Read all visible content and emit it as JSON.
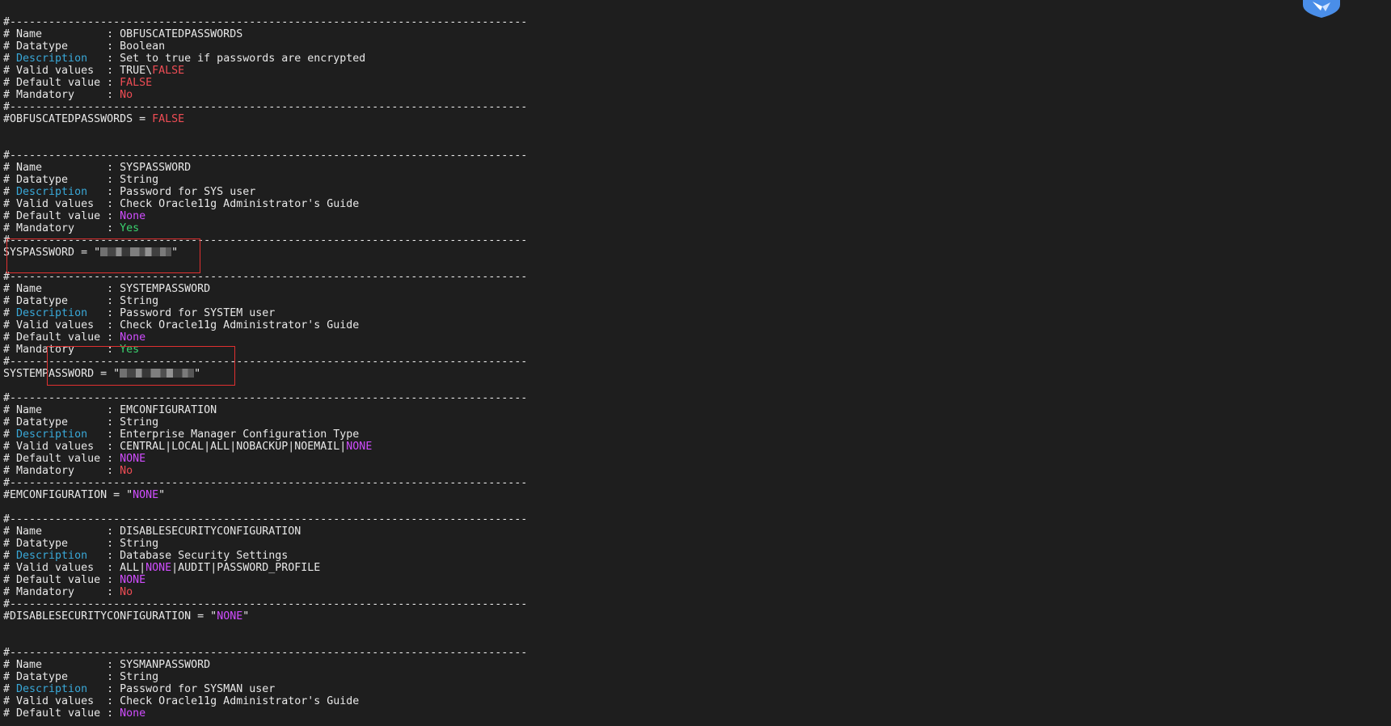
{
  "colors": {
    "background": "#1e1e1e",
    "text": "#e8e8e8",
    "keyword_cyan": "#39a8d8",
    "value_red": "#ef4d55",
    "value_green": "#3ad26f",
    "value_magenta": "#d04dff",
    "annotation_box": "#e03030",
    "badge_blue": "#4a8ee8"
  },
  "terminal": {
    "lines": [
      [
        {
          "t": "#--------------------------------------------------------------------------------",
          "c": "normal"
        }
      ],
      [
        {
          "t": "# Name          : OBFUSCATEDPASSWORDS",
          "c": "normal"
        }
      ],
      [
        {
          "t": "# Datatype      : Boolean",
          "c": "normal"
        }
      ],
      [
        {
          "t": "# ",
          "c": "normal"
        },
        {
          "t": "Description",
          "c": "cyan"
        },
        {
          "t": "   : Set to true if passwords are encrypted",
          "c": "normal"
        }
      ],
      [
        {
          "t": "# Valid values  : TRUE\\",
          "c": "normal"
        },
        {
          "t": "FALSE",
          "c": "red"
        }
      ],
      [
        {
          "t": "# Default value : ",
          "c": "normal"
        },
        {
          "t": "FALSE",
          "c": "red"
        }
      ],
      [
        {
          "t": "# Mandatory     : ",
          "c": "normal"
        },
        {
          "t": "No",
          "c": "red"
        }
      ],
      [
        {
          "t": "#--------------------------------------------------------------------------------",
          "c": "normal"
        }
      ],
      [
        {
          "t": "#OBFUSCATEDPASSWORDS = ",
          "c": "normal"
        },
        {
          "t": "FALSE",
          "c": "red"
        }
      ],
      [
        {
          "t": "",
          "c": "normal"
        }
      ],
      [
        {
          "t": "",
          "c": "normal"
        }
      ],
      [
        {
          "t": "#--------------------------------------------------------------------------------",
          "c": "normal"
        }
      ],
      [
        {
          "t": "# Name          : SYSPASSWORD",
          "c": "normal"
        }
      ],
      [
        {
          "t": "# Datatype      : String",
          "c": "normal"
        }
      ],
      [
        {
          "t": "# ",
          "c": "normal"
        },
        {
          "t": "Description",
          "c": "cyan"
        },
        {
          "t": "   : Password for SYS user",
          "c": "normal"
        }
      ],
      [
        {
          "t": "# Valid values  : Check Oracle11g Administrator's Guide",
          "c": "normal"
        }
      ],
      [
        {
          "t": "# Default value : ",
          "c": "normal"
        },
        {
          "t": "None",
          "c": "magenta"
        }
      ],
      [
        {
          "t": "# Mandatory     : ",
          "c": "normal"
        },
        {
          "t": "Yes",
          "c": "green"
        }
      ],
      [
        {
          "t": "#--------------------------------------------------------------------------------",
          "c": "normal"
        }
      ],
      [
        {
          "t": "SYSPASSWORD = \"",
          "c": "normal"
        },
        {
          "t": "",
          "c": "masked",
          "w": 88
        },
        {
          "t": "\"",
          "c": "normal"
        }
      ],
      [
        {
          "t": "",
          "c": "normal"
        }
      ],
      [
        {
          "t": "#--------------------------------------------------------------------------------",
          "c": "normal"
        }
      ],
      [
        {
          "t": "# Name          : SYSTEMPASSWORD",
          "c": "normal"
        }
      ],
      [
        {
          "t": "# Datatype      : String",
          "c": "normal"
        }
      ],
      [
        {
          "t": "# ",
          "c": "normal"
        },
        {
          "t": "Description",
          "c": "cyan"
        },
        {
          "t": "   : Password for SYSTEM user",
          "c": "normal"
        }
      ],
      [
        {
          "t": "# Valid values  : Check Oracle11g Administrator's Guide",
          "c": "normal"
        }
      ],
      [
        {
          "t": "# Default value : ",
          "c": "normal"
        },
        {
          "t": "None",
          "c": "magenta"
        }
      ],
      [
        {
          "t": "# Mandatory     : ",
          "c": "normal"
        },
        {
          "t": "Yes",
          "c": "green"
        }
      ],
      [
        {
          "t": "#--------------------------------------------------------------------------------",
          "c": "normal"
        }
      ],
      [
        {
          "t": "SYSTEMPASSWORD = \"",
          "c": "normal"
        },
        {
          "t": "",
          "c": "masked",
          "w": 92
        },
        {
          "t": "\"",
          "c": "normal"
        }
      ],
      [
        {
          "t": "",
          "c": "normal"
        }
      ],
      [
        {
          "t": "#--------------------------------------------------------------------------------",
          "c": "normal"
        }
      ],
      [
        {
          "t": "# Name          : EMCONFIGURATION",
          "c": "normal"
        }
      ],
      [
        {
          "t": "# Datatype      : String",
          "c": "normal"
        }
      ],
      [
        {
          "t": "# ",
          "c": "normal"
        },
        {
          "t": "Description",
          "c": "cyan"
        },
        {
          "t": "   : Enterprise Manager Configuration Type",
          "c": "normal"
        }
      ],
      [
        {
          "t": "# Valid values  : CENTRAL|LOCAL|ALL|NOBACKUP|NOEMAIL|",
          "c": "normal"
        },
        {
          "t": "NONE",
          "c": "magenta"
        }
      ],
      [
        {
          "t": "# Default value : ",
          "c": "normal"
        },
        {
          "t": "NONE",
          "c": "magenta"
        }
      ],
      [
        {
          "t": "# Mandatory     : ",
          "c": "normal"
        },
        {
          "t": "No",
          "c": "red"
        }
      ],
      [
        {
          "t": "#--------------------------------------------------------------------------------",
          "c": "normal"
        }
      ],
      [
        {
          "t": "#EMCONFIGURATION = \"",
          "c": "normal"
        },
        {
          "t": "NONE",
          "c": "magenta"
        },
        {
          "t": "\"",
          "c": "normal"
        }
      ],
      [
        {
          "t": "",
          "c": "normal"
        }
      ],
      [
        {
          "t": "#--------------------------------------------------------------------------------",
          "c": "normal"
        }
      ],
      [
        {
          "t": "# Name          : DISABLESECURITYCONFIGURATION",
          "c": "normal"
        }
      ],
      [
        {
          "t": "# Datatype      : String",
          "c": "normal"
        }
      ],
      [
        {
          "t": "# ",
          "c": "normal"
        },
        {
          "t": "Description",
          "c": "cyan"
        },
        {
          "t": "   : Database Security Settings",
          "c": "normal"
        }
      ],
      [
        {
          "t": "# Valid values  : ALL|",
          "c": "normal"
        },
        {
          "t": "NONE",
          "c": "magenta"
        },
        {
          "t": "|AUDIT|PASSWORD_PROFILE",
          "c": "normal"
        }
      ],
      [
        {
          "t": "# Default value : ",
          "c": "normal"
        },
        {
          "t": "NONE",
          "c": "magenta"
        }
      ],
      [
        {
          "t": "# Mandatory     : ",
          "c": "normal"
        },
        {
          "t": "No",
          "c": "red"
        }
      ],
      [
        {
          "t": "#--------------------------------------------------------------------------------",
          "c": "normal"
        }
      ],
      [
        {
          "t": "#DISABLESECURITYCONFIGURATION = \"",
          "c": "normal"
        },
        {
          "t": "NONE",
          "c": "magenta"
        },
        {
          "t": "\"",
          "c": "normal"
        }
      ],
      [
        {
          "t": "",
          "c": "normal"
        }
      ],
      [
        {
          "t": "",
          "c": "normal"
        }
      ],
      [
        {
          "t": "#--------------------------------------------------------------------------------",
          "c": "normal"
        }
      ],
      [
        {
          "t": "# Name          : SYSMANPASSWORD",
          "c": "normal"
        }
      ],
      [
        {
          "t": "# Datatype      : String",
          "c": "normal"
        }
      ],
      [
        {
          "t": "# ",
          "c": "normal"
        },
        {
          "t": "Description",
          "c": "cyan"
        },
        {
          "t": "   : Password for SYSMAN user",
          "c": "normal"
        }
      ],
      [
        {
          "t": "# Valid values  : Check Oracle11g Administrator's Guide",
          "c": "normal"
        }
      ],
      [
        {
          "t": "# Default value : ",
          "c": "normal"
        },
        {
          "t": "None",
          "c": "magenta"
        }
      ]
    ]
  },
  "annotations": [
    {
      "name": "syspassword-highlight"
    },
    {
      "name": "systempassword-highlight"
    }
  ],
  "badge": {
    "icon": "app-shield-icon"
  }
}
